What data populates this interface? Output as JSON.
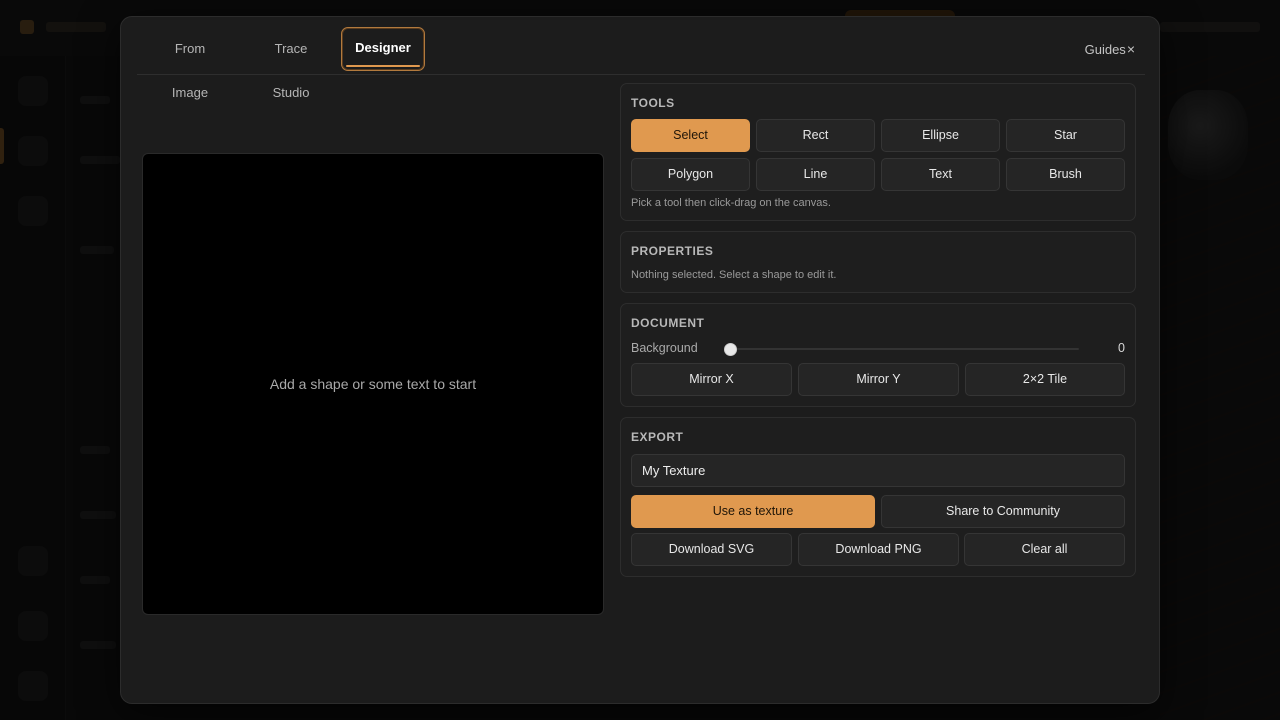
{
  "tabs": {
    "from_image": "From Image",
    "trace_studio": "Trace Studio",
    "designer": "Designer"
  },
  "guides_label": "Guides",
  "close_glyph": "×",
  "canvas": {
    "hint": "Add a shape or some text to start"
  },
  "tools": {
    "title": "TOOLS",
    "items": [
      "Select",
      "Rect",
      "Ellipse",
      "Star",
      "Polygon",
      "Line",
      "Text",
      "Brush"
    ],
    "active": "Select",
    "hint": "Pick a tool then click-drag on the canvas."
  },
  "properties": {
    "title": "PROPERTIES",
    "empty_text": "Nothing selected. Select a shape to edit it."
  },
  "document": {
    "title": "DOCUMENT",
    "background_label": "Background",
    "background_value": "0",
    "background_fraction": 0,
    "mirror_x": "Mirror X",
    "mirror_y": "Mirror Y",
    "tile": "2×2 Tile"
  },
  "export": {
    "title": "EXPORT",
    "name_value": "My Texture",
    "use_as_texture": "Use as texture",
    "share": "Share to Community",
    "download_svg": "Download SVG",
    "download_png": "Download PNG",
    "clear_all": "Clear all"
  },
  "colors": {
    "accent": "#e0994f",
    "modal_bg": "#1c1c1c",
    "canvas_bg": "#000000"
  }
}
